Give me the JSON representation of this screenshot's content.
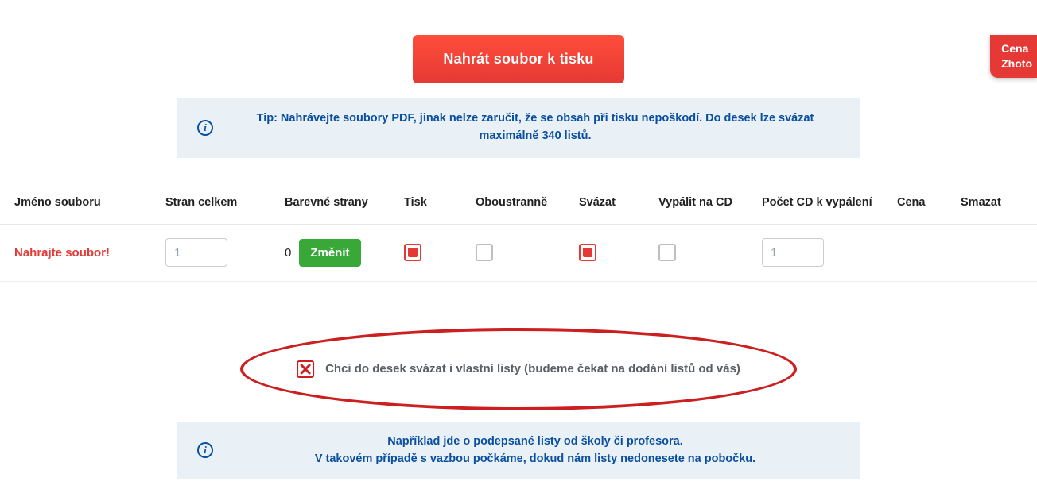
{
  "floatBadge": {
    "line1": "Cena",
    "line2": "Zhoto"
  },
  "uploadButton": "Nahrát soubor k tisku",
  "tip": {
    "prefix": "Tip:",
    "text": " Nahrávejte soubory PDF, jinak nelze zaručit, že se obsah při tisku nepoškodí. Do desek lze svázat maximálně 340 listů."
  },
  "headers": {
    "filename": "Jméno souboru",
    "pagesTotal": "Stran celkem",
    "colorPages": "Barevné strany",
    "print": "Tisk",
    "duplex": "Oboustranně",
    "bind": "Svázat",
    "burnCd": "Vypálit na CD",
    "cdCount": "Počet CD k vypálení",
    "price": "Cena",
    "delete": "Smazat"
  },
  "row": {
    "filename": "Nahrajte soubor!",
    "pagesTotal": "1",
    "colorPagesCount": "0",
    "changeLabel": "Změnit",
    "printChecked": true,
    "duplexChecked": false,
    "bindChecked": true,
    "burnCdChecked": false,
    "cdCount": "1"
  },
  "ownSheets": {
    "label": "Chci do desek svázat i vlastní listy (budeme čekat na dodání listů od vás)"
  },
  "example": {
    "line1": "Například jde o podepsané listy od školy či profesora.",
    "line2": "V takovém případě s vazbou počkáme, dokud nám listy nedonesete na pobočku."
  }
}
